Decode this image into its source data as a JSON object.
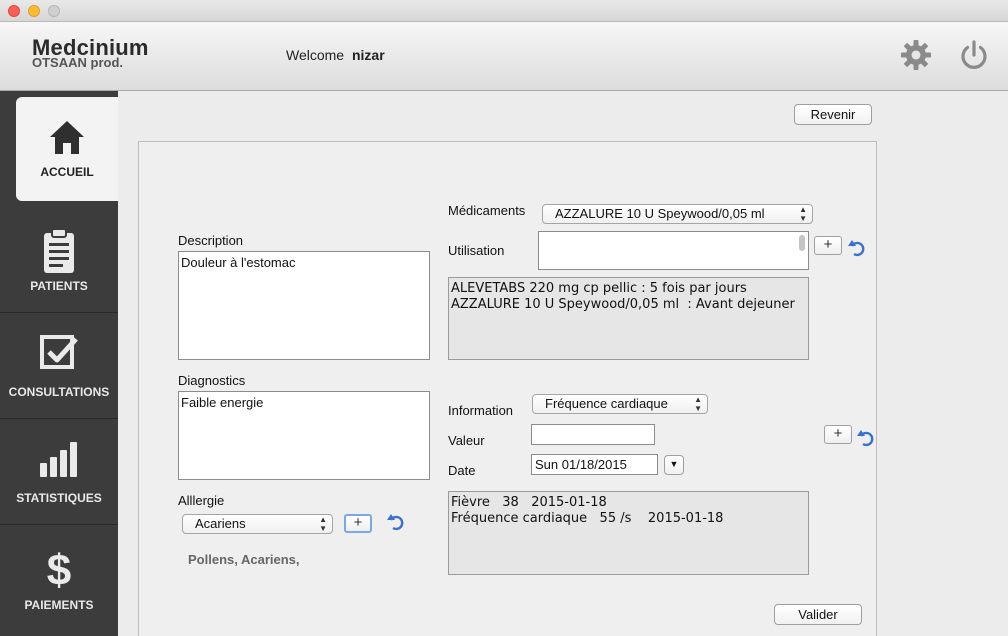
{
  "header": {
    "brand_name": "Medcinium",
    "brand_sub": "OTSAAN prod.",
    "welcome_label": "Welcome",
    "username": "nizar"
  },
  "sidebar": {
    "items": [
      {
        "label": "ACCUEIL",
        "icon": "home-icon",
        "active": true
      },
      {
        "label": "PATIENTS",
        "icon": "clipboard-icon"
      },
      {
        "label": "CONSULTATIONS",
        "icon": "checkbox-icon"
      },
      {
        "label": "STATISTIQUES",
        "icon": "bar-chart-icon"
      },
      {
        "label": "PAIEMENTS",
        "icon": "dollar-icon"
      }
    ]
  },
  "toolbar": {
    "back_label": "Revenir"
  },
  "form": {
    "description_label": "Description",
    "description_value": "Douleur à l'estomac",
    "diagnostics_label": "Diagnostics",
    "diagnostics_value": "Faible energie",
    "allergy_label": "Alllergie",
    "allergy_selected": "Acariens",
    "allergy_list": "Pollens, Acariens,",
    "medications_label": "Médicaments",
    "medication_selected": "AZZALURE 10 U Speywood/0,05 ml",
    "usage_label": "Utilisation",
    "usage_value": "",
    "prescriptions": [
      "ALEVETABS 220 mg cp pellic : 5 fois par jours",
      "AZZALURE 10 U Speywood/0,05 ml  : Avant dejeuner"
    ],
    "information_label": "Information",
    "information_selected": "Fréquence cardiaque",
    "value_label": "Valeur",
    "value_value": "",
    "date_label": "Date",
    "date_value": "Sun 01/18/2015",
    "measurements": [
      "Fièvre   38   2015-01-18",
      "Fréquence cardiaque   55 /s    2015-01-18"
    ],
    "add_label": "+",
    "submit_label": "Valider"
  },
  "colors": {
    "sidebar_bg": "#3c3c3c",
    "undo_icon": "#3b6fd0",
    "close_light": "#fc5f57",
    "minimize_light": "#fdbc2e"
  }
}
